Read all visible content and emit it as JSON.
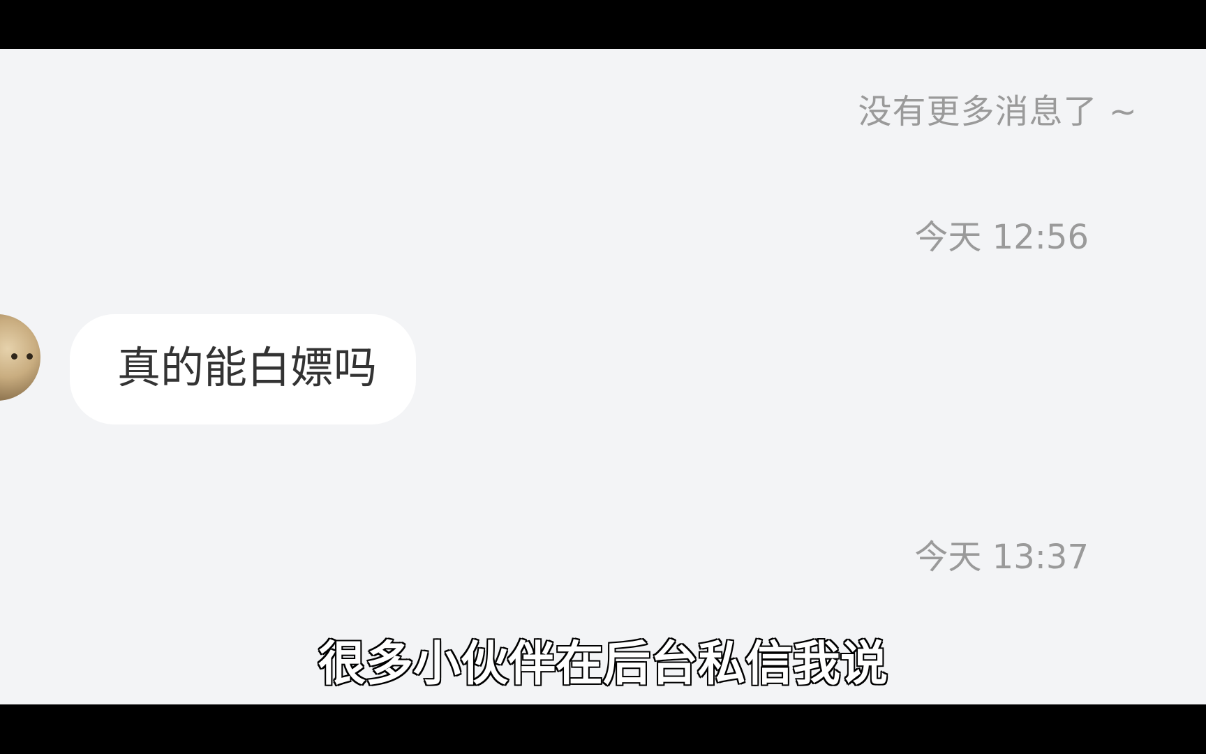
{
  "chat": {
    "no_more_messages": "没有更多消息了 ~",
    "timestamps": [
      "今天 12:56",
      "今天 13:37"
    ],
    "messages": [
      {
        "sender": "other",
        "text": "真的能白嫖吗"
      }
    ]
  },
  "video": {
    "subtitle": "很多小伙伴在后台私信我说"
  },
  "colors": {
    "chat_background": "#f3f4f6",
    "bubble_background": "#ffffff",
    "meta_text": "#9a9a9a",
    "message_text": "#333333",
    "letterbox": "#000000"
  }
}
